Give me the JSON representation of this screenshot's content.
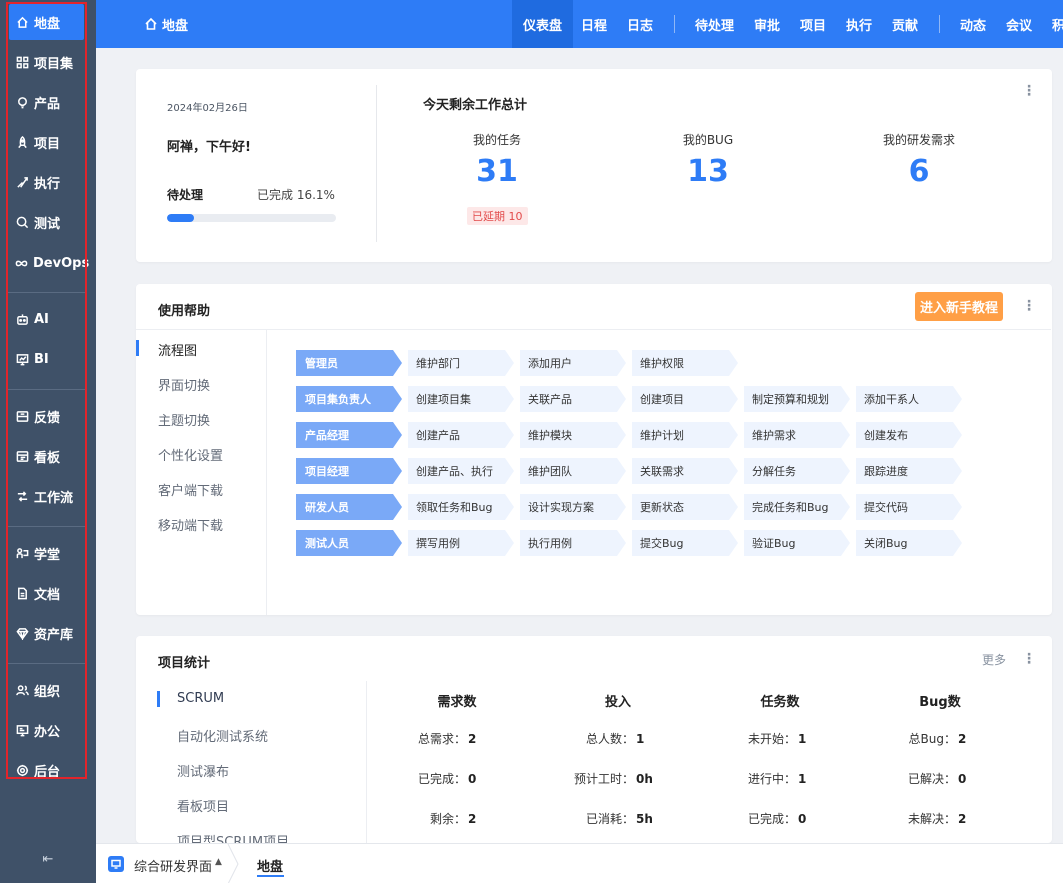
{
  "sidebar": {
    "items": [
      {
        "label": "地盘",
        "icon": "home-icon",
        "active": true
      },
      {
        "label": "项目集",
        "icon": "grid-icon"
      },
      {
        "label": "产品",
        "icon": "lightbulb-icon"
      },
      {
        "label": "项目",
        "icon": "rocket-icon"
      },
      {
        "label": "执行",
        "icon": "run-icon"
      },
      {
        "label": "测试",
        "icon": "search-icon"
      },
      {
        "label": "DevOps",
        "icon": "infinity-icon"
      },
      {
        "label": "AI",
        "icon": "robot-icon"
      },
      {
        "label": "BI",
        "icon": "chart-board-icon"
      },
      {
        "label": "反馈",
        "icon": "feedback-icon"
      },
      {
        "label": "看板",
        "icon": "kanban-icon"
      },
      {
        "label": "工作流",
        "icon": "workflow-icon"
      },
      {
        "label": "学堂",
        "icon": "school-icon"
      },
      {
        "label": "文档",
        "icon": "document-icon"
      },
      {
        "label": "资产库",
        "icon": "diamond-icon"
      },
      {
        "label": "组织",
        "icon": "people-icon"
      },
      {
        "label": "办公",
        "icon": "monitor-icon"
      },
      {
        "label": "后台",
        "icon": "gear-icon"
      }
    ],
    "collapse": "⇤"
  },
  "topbar": {
    "home": "地盘",
    "nav": [
      "仪表盘",
      "日程",
      "日志",
      "待处理",
      "审批",
      "项目",
      "执行",
      "贡献",
      "动态",
      "会议",
      "积"
    ],
    "active": "仪表盘"
  },
  "welcome": {
    "date": "2024年02月26日",
    "greeting": "阿禅，下午好!",
    "pending_label": "待处理",
    "done_label": "已完成 16.1%",
    "progress": 0.161
  },
  "summary": {
    "title": "今天剩余工作总计",
    "stats": [
      {
        "label": "我的任务",
        "value": "31"
      },
      {
        "label": "我的BUG",
        "value": "13"
      },
      {
        "label": "我的研发需求",
        "value": "6"
      }
    ],
    "overdue": "已延期 10"
  },
  "help": {
    "title": "使用帮助",
    "tutorial_button": "进入新手教程",
    "menu": [
      "流程图",
      "界面切换",
      "主题切换",
      "个性化设置",
      "客户端下载",
      "移动端下载"
    ],
    "flows": [
      {
        "role": "管理员",
        "steps": [
          "维护部门",
          "添加用户",
          "维护权限"
        ]
      },
      {
        "role": "项目集负责人",
        "steps": [
          "创建项目集",
          "关联产品",
          "创建项目",
          "制定预算和规划",
          "添加干系人"
        ]
      },
      {
        "role": "产品经理",
        "steps": [
          "创建产品",
          "维护模块",
          "维护计划",
          "维护需求",
          "创建发布"
        ]
      },
      {
        "role": "项目经理",
        "steps": [
          "创建产品、执行",
          "维护团队",
          "关联需求",
          "分解任务",
          "跟踪进度"
        ]
      },
      {
        "role": "研发人员",
        "steps": [
          "领取任务和Bug",
          "设计实现方案",
          "更新状态",
          "完成任务和Bug",
          "提交代码"
        ]
      },
      {
        "role": "测试人员",
        "steps": [
          "撰写用例",
          "执行用例",
          "提交Bug",
          "验证Bug",
          "关闭Bug"
        ]
      }
    ]
  },
  "projects": {
    "title": "项目统计",
    "more": "更多",
    "list": [
      "SCRUM",
      "自动化测试系统",
      "测试瀑布",
      "看板项目",
      "项目型SCRUM项目"
    ],
    "columns": [
      {
        "title": "需求数",
        "rows": [
          [
            "总需求：",
            "2"
          ],
          [
            "已完成：",
            "0"
          ],
          [
            "剩余：",
            "2"
          ]
        ]
      },
      {
        "title": "投入",
        "rows": [
          [
            "总人数：",
            "1"
          ],
          [
            "预计工时：",
            "0h"
          ],
          [
            "已消耗：",
            "5h"
          ]
        ]
      },
      {
        "title": "任务数",
        "rows": [
          [
            "未开始：",
            "1"
          ],
          [
            "进行中：",
            "1"
          ],
          [
            "已完成：",
            "0"
          ]
        ]
      },
      {
        "title": "Bug数",
        "rows": [
          [
            "总Bug：",
            "2"
          ],
          [
            "已解决：",
            "0"
          ],
          [
            "未解决：",
            "2"
          ]
        ]
      }
    ]
  },
  "bottombar": {
    "workspace": "综合研发界面",
    "tab": "地盘"
  },
  "colors": {
    "primary": "#2e7cf6",
    "sidebar": "#3f5168",
    "tutorial": "#ff9f46",
    "overdue": "#e24b4b",
    "highlight_box": "#e3242b"
  }
}
